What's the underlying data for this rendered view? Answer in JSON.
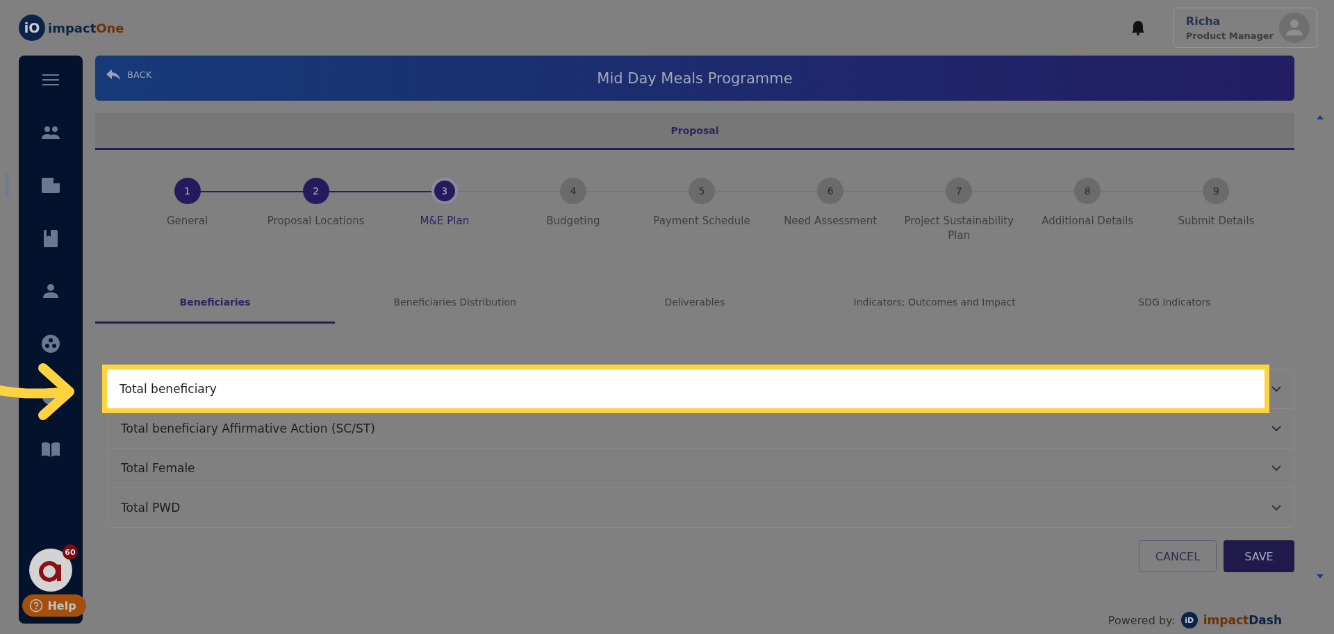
{
  "logo": {
    "mark": "iO",
    "name_a": "impact",
    "name_b": "One"
  },
  "user": {
    "name": "Richa",
    "role": "Product Manager"
  },
  "sidebar": {
    "items": [
      {
        "kind": "menu",
        "selected": false
      },
      {
        "kind": "people",
        "selected": false
      },
      {
        "kind": "document",
        "selected": true
      },
      {
        "kind": "book",
        "selected": false
      },
      {
        "kind": "person",
        "selected": false
      },
      {
        "kind": "palette",
        "selected": false
      },
      {
        "kind": "hidden",
        "selected": false
      },
      {
        "kind": "reader",
        "selected": false
      }
    ],
    "badge": "60",
    "help": "Help"
  },
  "banner": {
    "back": "BACK",
    "title": "Mid Day Meals Programme"
  },
  "section": "Proposal",
  "steps": [
    {
      "number": "1",
      "label": "General",
      "completed": true,
      "current": false
    },
    {
      "number": "2",
      "label": "Proposal Locations",
      "completed": true,
      "current": false
    },
    {
      "number": "3",
      "label": "M&E Plan",
      "completed": false,
      "current": true
    },
    {
      "number": "4",
      "label": "Budgeting",
      "completed": false,
      "current": false
    },
    {
      "number": "5",
      "label": "Payment Schedule",
      "completed": false,
      "current": false
    },
    {
      "number": "6",
      "label": "Need Assessment",
      "completed": false,
      "current": false
    },
    {
      "number": "7",
      "label": "Project Sustainability Plan",
      "completed": false,
      "current": false
    },
    {
      "number": "8",
      "label": "Additional Details",
      "completed": false,
      "current": false
    },
    {
      "number": "9",
      "label": "Submit Details",
      "completed": false,
      "current": false
    }
  ],
  "tabs": [
    {
      "label": "Beneficiaries",
      "selected": true
    },
    {
      "label": "Beneficiaries Distribution",
      "selected": false
    },
    {
      "label": "Deliverables",
      "selected": false
    },
    {
      "label": "Indicators: Outcomes and Impact",
      "selected": false
    },
    {
      "label": "SDG Indicators",
      "selected": false
    }
  ],
  "rows": [
    {
      "label": "Total beneficiary",
      "highlighted": true
    },
    {
      "label": "Total beneficiary Affirmative Action (SC/ST)",
      "highlighted": false
    },
    {
      "label": "Total Female",
      "highlighted": false
    },
    {
      "label": "Total PWD",
      "highlighted": false
    }
  ],
  "buttons": {
    "cancel": "CANCEL",
    "save": "SAVE"
  },
  "footer": {
    "powered": "Powered by:",
    "mark": "iD",
    "name_a": "impact",
    "name_b": "Dash"
  }
}
